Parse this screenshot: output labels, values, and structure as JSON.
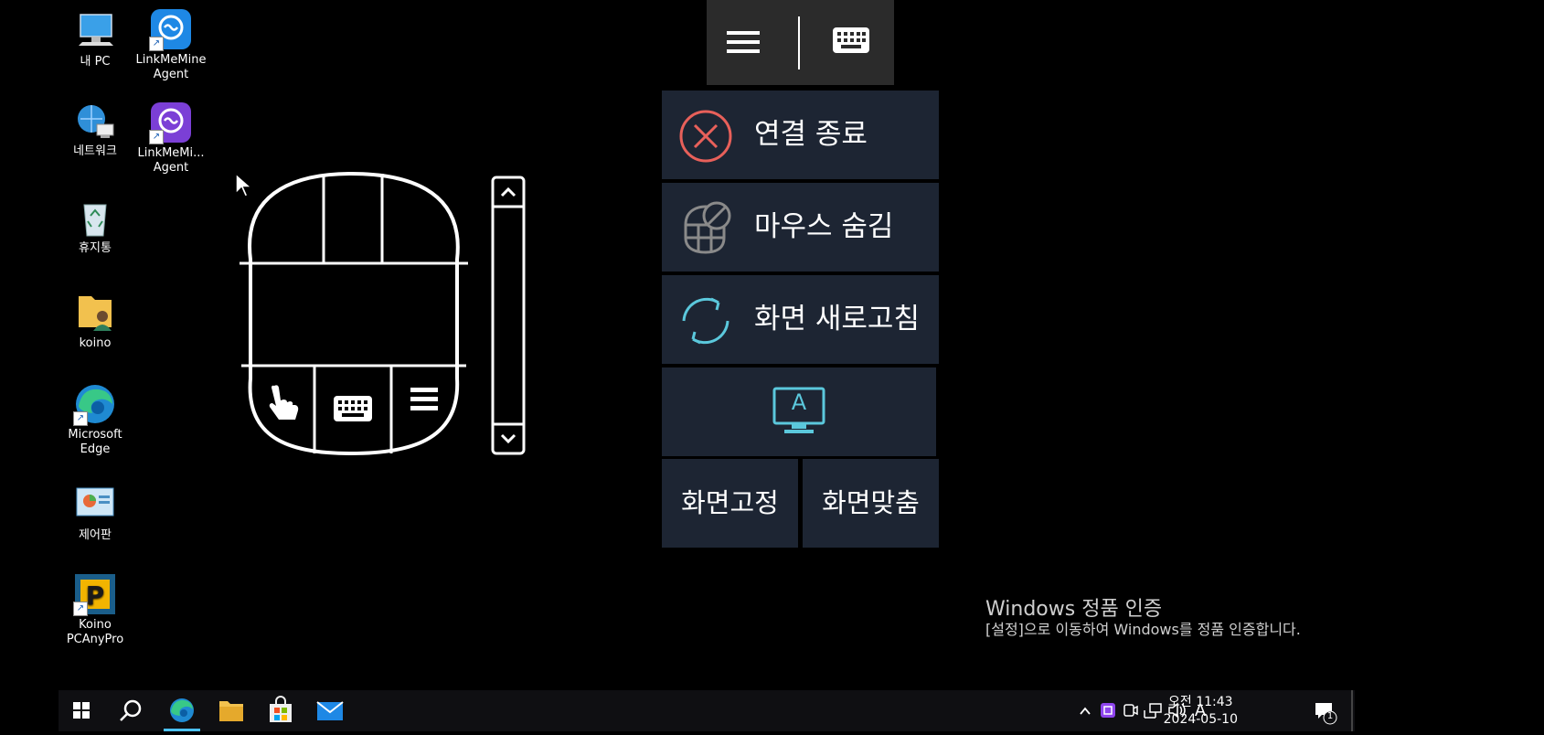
{
  "desktop_icons": [
    {
      "name": "this-pc",
      "label": "내 PC"
    },
    {
      "name": "linkmemine-agent-1",
      "label": "LinkMeMine Agent"
    },
    {
      "name": "network",
      "label": "네트워크"
    },
    {
      "name": "linkmemine-agent-2",
      "label": "LinkMeMi... Agent"
    },
    {
      "name": "recycle-bin",
      "label": "휴지통"
    },
    {
      "name": "koino-folder",
      "label": "koino"
    },
    {
      "name": "microsoft-edge",
      "label": "Microsoft Edge"
    },
    {
      "name": "control-panel",
      "label": "제어판"
    },
    {
      "name": "koino-pcanypro",
      "label": "Koino PCAnyPro"
    }
  ],
  "remote_menu": {
    "disconnect": "연결 종료",
    "hide_mouse": "마우스 숨김",
    "refresh_screen": "화면 새로고침",
    "monitor_letter": "A",
    "fix_screen": "화면고정",
    "fit_screen": "화면맞춤"
  },
  "watermark": {
    "title": "Windows 정품 인증",
    "subtitle": "[설정]으로 이동하여 Windows를 정품 인증합니다."
  },
  "taskbar": {
    "clock_ampm_time": "오전 11:43",
    "clock_date": "2024-05-10",
    "ime_indicator": "A",
    "notification_count": "1"
  },
  "colors": {
    "panel_bg": "#1d2533",
    "toolbar_bg": "#2b2b2b",
    "disconnect_red": "#e8605a",
    "refresh_cyan": "#5bc8dc",
    "taskbar_bg": "#0f0f12",
    "edge_active_underline": "#4cc2ff"
  }
}
